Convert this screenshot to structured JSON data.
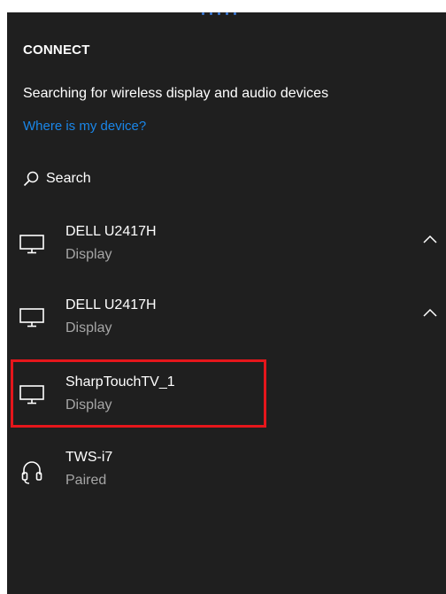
{
  "panel": {
    "title": "CONNECT",
    "status": "Searching for wireless display and audio devices",
    "help_link": "Where is my device?",
    "search_label": "Search"
  },
  "devices": [
    {
      "name": "DELL U2417H",
      "sub": "Display",
      "icon": "monitor-icon",
      "chevron": "chevron-up-icon"
    },
    {
      "name": "DELL U2417H",
      "sub": "Display",
      "icon": "monitor-icon",
      "chevron": "chevron-up-icon"
    },
    {
      "name": "SharpTouchTV_1",
      "sub": "Display",
      "icon": "monitor-icon",
      "highlighted": true
    },
    {
      "name": "TWS-i7",
      "sub": "Paired",
      "icon": "headphones-icon"
    }
  ],
  "colors": {
    "panel_bg": "#1f1f1f",
    "link": "#1a86e8",
    "secondary_text": "#a6a6a6",
    "highlight_border": "#e5161b",
    "progress_dots": "#3b7de0"
  }
}
